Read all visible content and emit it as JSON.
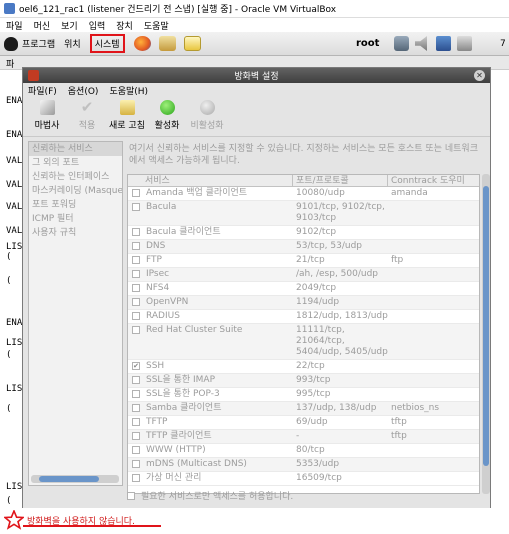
{
  "window": {
    "title": "oel6_121_rac1 (listener 건드리기 전 스냅) [실행 중] - Oracle VM VirtualBox"
  },
  "vbox_menu": [
    "파일",
    "머신",
    "보기",
    "입력",
    "장치",
    "도움말"
  ],
  "panel": {
    "apps": "프로그램",
    "places": "위치",
    "system": "시스템",
    "user": "root",
    "clock": "7"
  },
  "terminal": {
    "lines": [
      "ENA",
      "ENA",
      "VAL",
      "VAL",
      "VAL",
      "VAL",
      "LIS",
      "(",
      "(",
      "ENA",
      "LIS",
      "(",
      "LIS",
      "(",
      "LIS",
      "("
    ],
    "top_text": "파"
  },
  "dialog": {
    "title": "방화벽 설정",
    "menu": [
      "파일(F)",
      "옵션(O)",
      "도움말(H)"
    ],
    "toolbar": [
      {
        "label": "마법사",
        "icon": "wizard-icon",
        "enabled": true
      },
      {
        "label": "적용",
        "icon": "apply-check-icon",
        "enabled": false
      },
      {
        "label": "새로 고침",
        "icon": "reload-icon",
        "enabled": true
      },
      {
        "label": "활성화",
        "icon": "enable-green-icon",
        "enabled": true
      },
      {
        "label": "비활성화",
        "icon": "disable-grey-icon",
        "enabled": false
      }
    ],
    "nav": [
      "신뢰하는 서비스",
      "그 외의 포트",
      "신뢰하는 인터페이스",
      "마스커레이딩 (Masquer",
      "포트 포워딩",
      "ICMP 필터",
      "사용자 규칙"
    ],
    "description": "여기서 신뢰하는 서비스를 지정할 수 있습니다. 지정하는 서비스는 모든 호스트 또는 네트워크에서 액세스 가능하게 됩니다.",
    "columns": [
      "서비스",
      "포트/프로토콜",
      "Conntrack 도우미"
    ],
    "services": [
      {
        "name": "Amanda 백업 클라이언트",
        "port": "10080/udp",
        "helper": "amanda",
        "checked": false
      },
      {
        "name": "Bacula",
        "port": "9101/tcp, 9102/tcp, 9103/tcp",
        "helper": "",
        "checked": false
      },
      {
        "name": "Bacula 클라이언트",
        "port": "9102/tcp",
        "helper": "",
        "checked": false
      },
      {
        "name": "DNS",
        "port": "53/tcp, 53/udp",
        "helper": "",
        "checked": false
      },
      {
        "name": "FTP",
        "port": "21/tcp",
        "helper": "ftp",
        "checked": false
      },
      {
        "name": "IPsec",
        "port": "/ah, /esp, 500/udp",
        "helper": "",
        "checked": false
      },
      {
        "name": "NFS4",
        "port": "2049/tcp",
        "helper": "",
        "checked": false
      },
      {
        "name": "OpenVPN",
        "port": "1194/udp",
        "helper": "",
        "checked": false
      },
      {
        "name": "RADIUS",
        "port": "1812/udp, 1813/udp",
        "helper": "",
        "checked": false
      },
      {
        "name": "Red Hat Cluster Suite",
        "port": "11111/tcp, 21064/tcp, 5404/udp, 5405/udp",
        "helper": "",
        "checked": false
      },
      {
        "name": "SSH",
        "port": "22/tcp",
        "helper": "",
        "checked": true
      },
      {
        "name": "SSL을 통한 IMAP",
        "port": "993/tcp",
        "helper": "",
        "checked": false
      },
      {
        "name": "SSL을 통한 POP-3",
        "port": "995/tcp",
        "helper": "",
        "checked": false
      },
      {
        "name": "Samba 클라이언트",
        "port": "137/udp, 138/udp",
        "helper": "netbios_ns",
        "checked": false
      },
      {
        "name": "TFTP",
        "port": "69/udp",
        "helper": "tftp",
        "checked": false
      },
      {
        "name": "TFTP 클라이언트",
        "port": "-",
        "helper": "tftp",
        "checked": false
      },
      {
        "name": "WWW (HTTP)",
        "port": "80/tcp",
        "helper": "",
        "checked": false
      },
      {
        "name": "mDNS (Multicast DNS)",
        "port": "5353/udp",
        "helper": "",
        "checked": false
      },
      {
        "name": "가상 머신 관리",
        "port": "16509/tcp",
        "helper": "",
        "checked": false
      }
    ],
    "trusted_note": "필요한 서비스로만 액세스를 허용합니다."
  },
  "status": {
    "text": "방화벽을 사용하지 않습니다."
  },
  "colors": {
    "highlight": "#e0141a",
    "status_text": "#d01818",
    "scroll_thumb": "#6a95c9"
  }
}
